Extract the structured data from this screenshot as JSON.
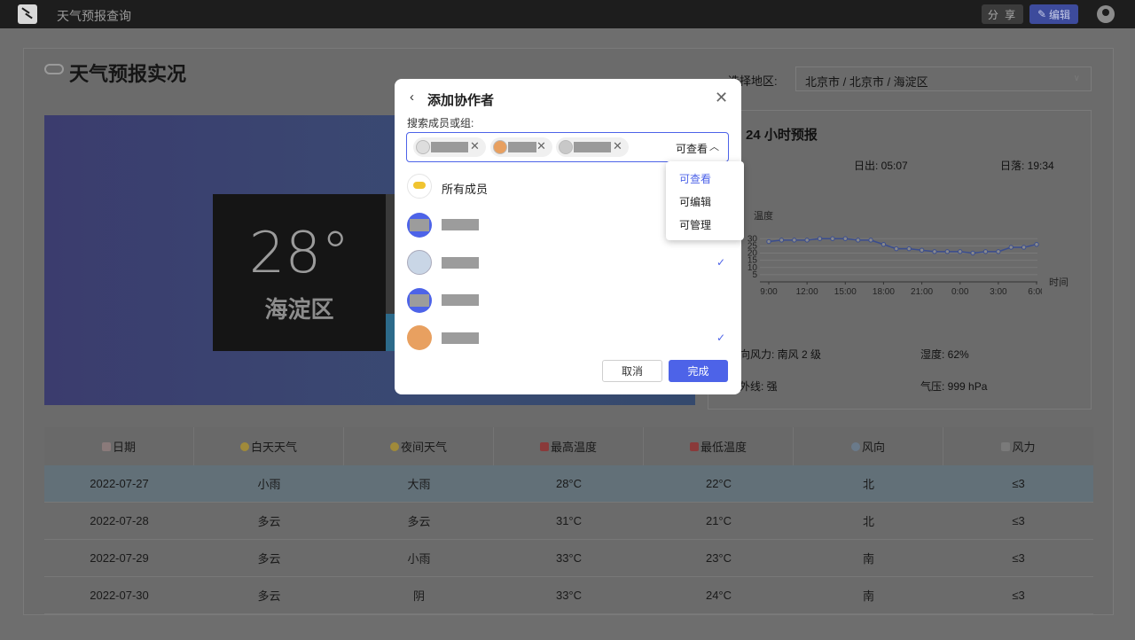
{
  "app": {
    "title": "天气预报查询",
    "share_label": "分 享",
    "edit_label": "编辑"
  },
  "page": {
    "title": "天气预报实况",
    "region_label": "选择地区:",
    "region_value": "北京市 / 北京市 / 海淀区"
  },
  "hero": {
    "temperature": "28°",
    "area": "海淀区"
  },
  "forecast": {
    "title": "24 小时预报",
    "sunrise": "日出: 05:07",
    "sunset": "日落: 19:34",
    "ylabel": "温度",
    "xlabel": "时间",
    "wind": "向风力: 南风 2 级",
    "humidity": "湿度: 62%",
    "uv": "外线: 强",
    "pressure": "气压: 999 hPa"
  },
  "chart_data": {
    "type": "line",
    "ylabel": "温度",
    "xlabel": "时间",
    "yticks": [
      "30",
      "25",
      "20",
      "15",
      "10",
      "5"
    ],
    "ylim": [
      0,
      32
    ],
    "xticks": [
      "9:00",
      "12:00",
      "15:00",
      "18:00",
      "21:00",
      "0:00",
      "3:00",
      "6:00"
    ],
    "values": [
      28,
      29,
      29,
      29,
      30,
      30,
      30,
      29,
      29,
      26,
      23,
      23,
      22,
      21,
      21,
      21,
      20,
      21,
      21,
      24,
      24,
      26
    ],
    "colors": {
      "line": "#3a4d8f"
    }
  },
  "table": {
    "headers": [
      "日期",
      "白天天气",
      "夜间天气",
      "最高温度",
      "最低温度",
      "风向",
      "风力"
    ],
    "rows": [
      [
        "2022-07-27",
        "小雨",
        "大雨",
        "28°C",
        "22°C",
        "北",
        "≤3"
      ],
      [
        "2022-07-28",
        "多云",
        "多云",
        "31°C",
        "21°C",
        "北",
        "≤3"
      ],
      [
        "2022-07-29",
        "多云",
        "小雨",
        "33°C",
        "23°C",
        "南",
        "≤3"
      ],
      [
        "2022-07-30",
        "多云",
        "阴",
        "33°C",
        "24°C",
        "南",
        "≤3"
      ]
    ]
  },
  "modal": {
    "title": "添加协作者",
    "search_label": "搜索成员或组:",
    "permission": "可查看",
    "all_members": "所有成员",
    "cancel": "取消",
    "done": "完成",
    "permission_options": [
      "可查看",
      "可编辑",
      "可管理"
    ]
  }
}
